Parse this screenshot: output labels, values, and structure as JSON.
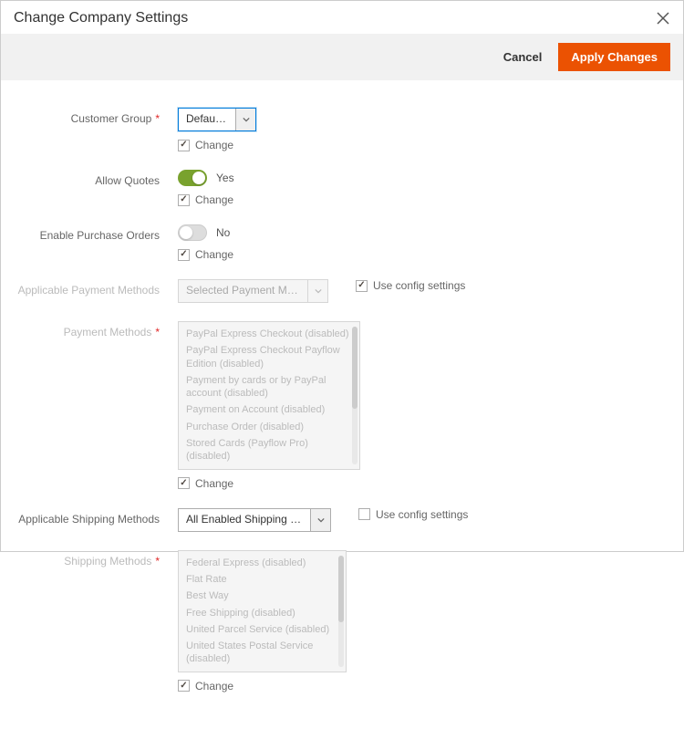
{
  "modalTitle": "Change Company Settings",
  "actions": {
    "cancel": "Cancel",
    "apply": "Apply Changes"
  },
  "labels": {
    "customerGroup": "Customer Group",
    "allowQuotes": "Allow Quotes",
    "enablePurchaseOrders": "Enable Purchase Orders",
    "applicablePaymentMethods": "Applicable Payment Methods",
    "paymentMethods": "Payment Methods",
    "applicableShippingMethods": "Applicable Shipping Methods",
    "shippingMethods": "Shipping Methods",
    "change": "Change",
    "useConfig": "Use config settings",
    "yes": "Yes",
    "no": "No"
  },
  "values": {
    "customerGroup": "Default (Ge…",
    "applicablePaymentMethods": "Selected Payment Methods",
    "applicableShippingMethods": "All Enabled Shipping Methods"
  },
  "paymentMethodOptions": [
    "PayPal Express Checkout (disabled)",
    "PayPal Express Checkout Payflow Edition (disabled)",
    "Payment by cards or by PayPal account (disabled)",
    "Payment on Account (disabled)",
    "Purchase Order (disabled)",
    "Stored Cards (Payflow Pro) (disabled)"
  ],
  "shippingMethodOptions": [
    "Federal Express (disabled)",
    "Flat Rate",
    "Best Way",
    "Free Shipping (disabled)",
    "United Parcel Service (disabled)",
    "United States Postal Service (disabled)"
  ]
}
